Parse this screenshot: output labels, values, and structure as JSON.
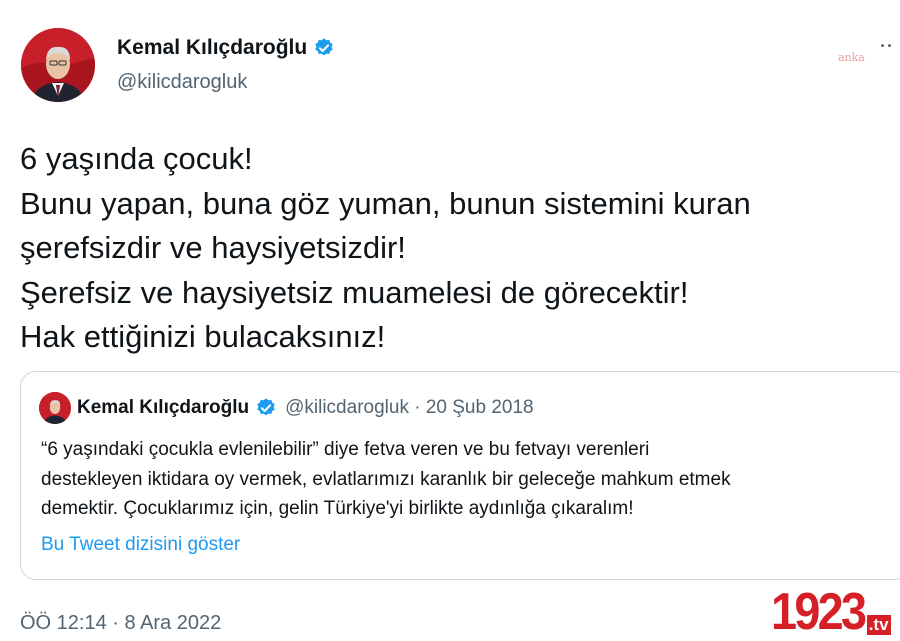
{
  "author": {
    "name": "Kemal Kılıçdaroğlu",
    "handle": "@kilicdarogluk"
  },
  "watermark": "anka",
  "more_icon": "more-dots-icon",
  "tweet_lines": [
    "6 yaşında çocuk!",
    "Bunu yapan, buna göz yuman, bunun sistemini kuran",
    "şerefsizdir ve haysiyetsizdir!",
    "Şerefsiz ve haysiyetsiz muamelesi de görecektir!",
    "Hak ettiğinizi bulacaksınız!"
  ],
  "quote": {
    "name": "Kemal Kılıçdaroğlu",
    "handle_date": "@kilicdarogluk · 20 Şub 2018",
    "body_lines": [
      "“6 yaşındaki çocukla evlenilebilir” diye fetva veren ve bu fetvayı verenleri",
      "destekleyen iktidara oy vermek, evlatlarımızı karanlık bir geleceğe mahkum etmek",
      "demektir. Çocuklarımız için, gelin Türkiye'yi birlikte aydınlığa çıkaralım!"
    ],
    "thread_link": "Bu Tweet dizisini göster"
  },
  "timestamp": "ÖÖ 12:14 · 8 Ara 2022",
  "logo": {
    "number": "1923",
    "suffix": ".tv"
  },
  "colors": {
    "verified": "#1d9bf0",
    "link": "#1d9bf0",
    "secondary_text": "#536471",
    "logo_red": "#d61f26"
  }
}
